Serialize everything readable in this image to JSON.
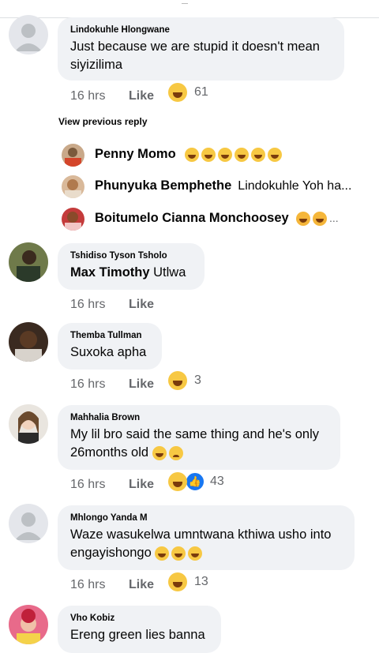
{
  "comments": [
    {
      "author": "Lindokuhle Hlongwane",
      "text": "Just because we are stupid it doesn't mean siyizilima",
      "time": "16 hrs",
      "like": "Like",
      "count": "61"
    },
    {
      "author": "Tshidiso Tyson Tsholo",
      "mention": "Max Timothy",
      "text": "Utlwa",
      "time": "16 hrs",
      "like": "Like"
    },
    {
      "author": "Themba Tullman",
      "text": "Suxoka apha",
      "time": "16 hrs",
      "like": "Like",
      "count": "3"
    },
    {
      "author": "Mahhalia Brown",
      "text": "My lil bro said the same thing and he's only 26months old",
      "time": "16 hrs",
      "like": "Like",
      "count": "43"
    },
    {
      "author": "Mhlongo Yanda M",
      "text": "Waze wasukelwa umntwana kthiwa usho into engayishongo",
      "time": "16 hrs",
      "like": "Like",
      "count": "13"
    },
    {
      "author": "Vho Kobiz",
      "text": "Ereng green lies banna"
    }
  ],
  "view_previous": "View previous reply",
  "replies": [
    {
      "name": "Penny Momo"
    },
    {
      "name": "Phunyuka Bemphethe",
      "text": "Lindokuhle Yoh ha..."
    },
    {
      "name": "Boitumelo Cianna Monchoosey",
      "ellipsis": "..."
    }
  ],
  "icons": {
    "avatar": "person-silhouette-icon",
    "laugh": "laughing-emoji-icon",
    "like": "thumbs-up-icon"
  },
  "colors": {
    "bubble": "#f0f2f5",
    "meta": "#65676b",
    "like_blue": "#1877f2"
  }
}
